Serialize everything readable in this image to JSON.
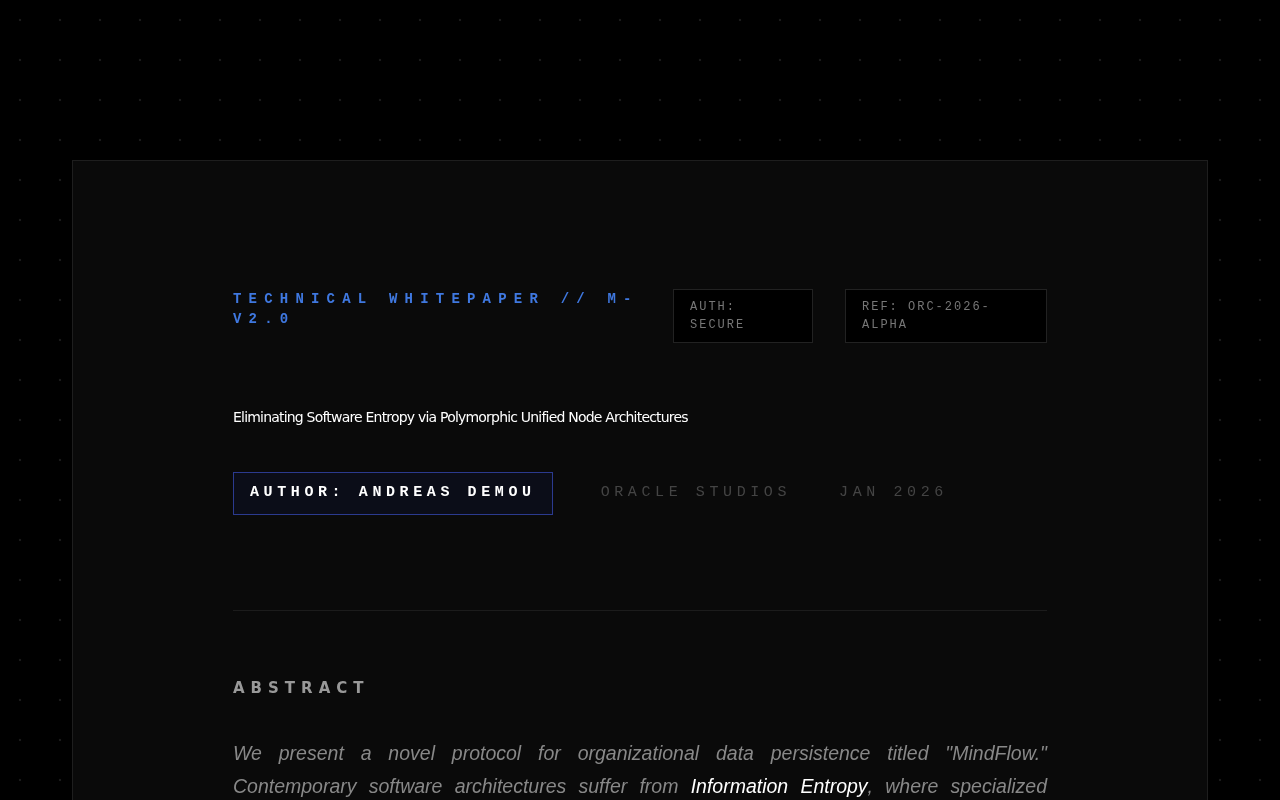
{
  "header": {
    "label": "TECHNICAL WHITEPAPER // M-V2.0",
    "tags": [
      "AUTH: SECURE",
      "REF: ORC-2026-ALPHA"
    ]
  },
  "title": "Eliminating Software Entropy via Polymorphic Unified Node Architectures",
  "meta": {
    "author": "AUTHOR: ANDREAS DEMOU",
    "items": [
      "ORACLE STUDIOS",
      "JAN 2026"
    ]
  },
  "abstract": {
    "heading": "ABSTRACT",
    "text": "We present a novel protocol for organizational data persistence titled \"MindFlow.\" Contemporary software architectures suffer from **Information Entropy**, where specialized"
  }
}
